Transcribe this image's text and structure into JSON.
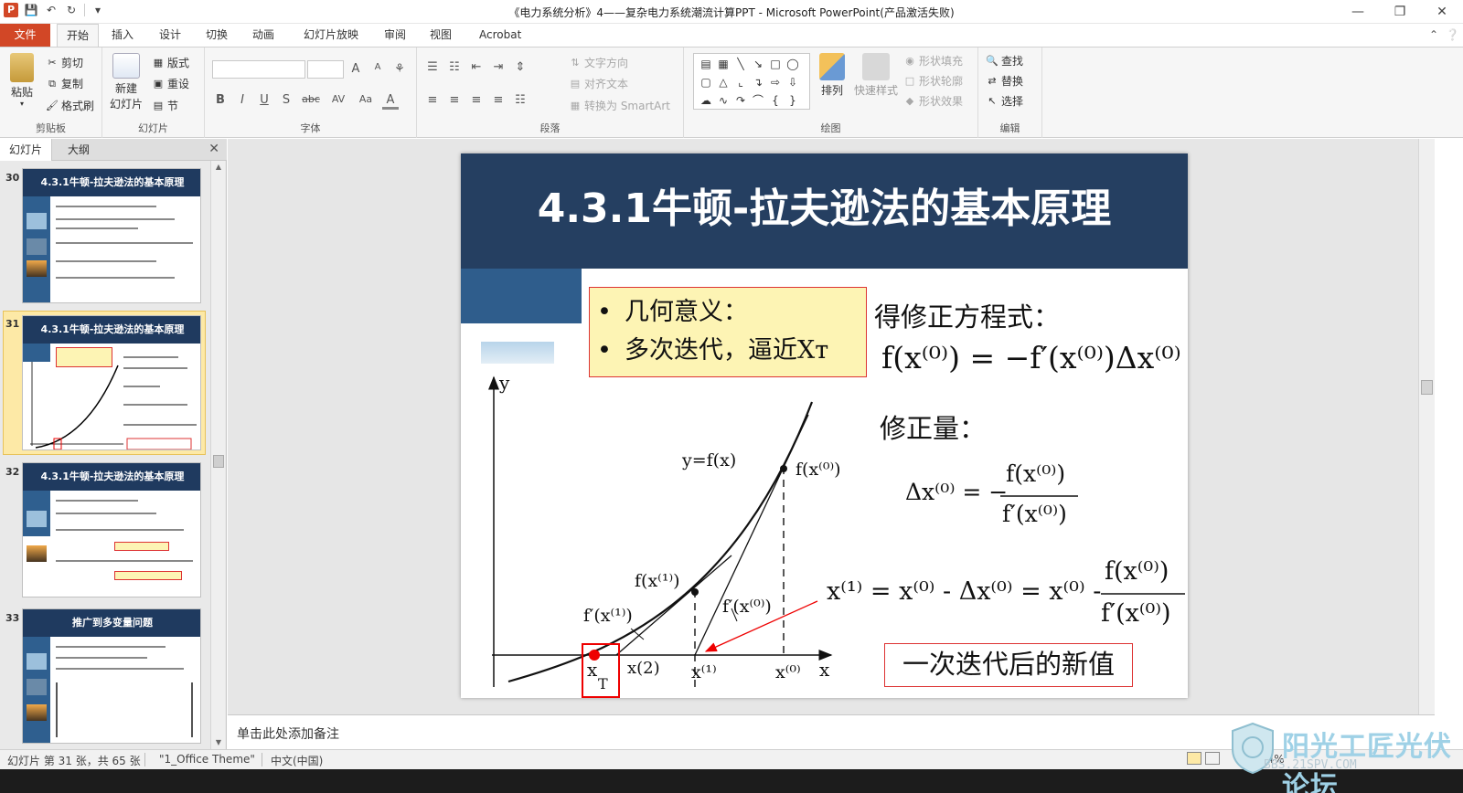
{
  "window": {
    "title": "《电力系统分析》4——复杂电力系统潮流计算PPT  -  Microsoft PowerPoint(产品激活失败)",
    "app_badge": "P"
  },
  "tabs": [
    "文件",
    "开始",
    "插入",
    "设计",
    "切换",
    "动画",
    "幻灯片放映",
    "审阅",
    "视图",
    "Acrobat"
  ],
  "ribbon": {
    "clipboard": {
      "paste": "粘贴",
      "cut": "剪切",
      "copy": "复制",
      "format_painter": "格式刷",
      "label": "剪贴板"
    },
    "slides": {
      "new_slide_1": "新建",
      "new_slide_2": "幻灯片",
      "layout": "版式",
      "reset": "重设",
      "section": "节",
      "label": "幻灯片"
    },
    "font": {
      "label": "字体",
      "bold": "B",
      "italic": "I",
      "underline": "U",
      "shadow": "S",
      "strike": "abc",
      "spacing": "AV",
      "case": "Aa",
      "color": "A",
      "grow": "A",
      "shrink": "A"
    },
    "paragraph": {
      "text_direction": "文字方向",
      "align_text": "对齐文本",
      "smartart": "转换为 SmartArt",
      "label": "段落"
    },
    "drawing": {
      "arrange": "排列",
      "quick_styles": "快速样式",
      "shape_fill": "形状填充",
      "shape_outline": "形状轮廓",
      "shape_effects": "形状效果",
      "label": "绘图"
    },
    "editing": {
      "find": "查找",
      "replace": "替换",
      "select": "选择",
      "label": "编辑"
    }
  },
  "left_panel": {
    "tab_slides": "幻灯片",
    "tab_outline": "大纲",
    "thumbnails": [
      {
        "num": "30",
        "title": "4.3.1牛顿-拉夫逊法的基本原理"
      },
      {
        "num": "31",
        "title": "4.3.1牛顿-拉夫逊法的基本原理"
      },
      {
        "num": "32",
        "title": "4.3.1牛顿-拉夫逊法的基本原理"
      },
      {
        "num": "33",
        "title": "推广到多变量问题"
      }
    ]
  },
  "slide": {
    "title": "4.3.1牛顿-拉夫逊法的基本原理",
    "bullets": [
      "几何意义：",
      "多次迭代，逼近Xт"
    ],
    "corr_eq_label": "得修正方程式：",
    "corr_eq": "f(x⁽⁰⁾) = −f′(x⁽⁰⁾)Δx⁽⁰⁾",
    "corr_amount_label": "修正量：",
    "corr_amount_lhs": "Δx⁽⁰⁾ = −",
    "corr_amount_num": "f(x⁽⁰⁾)",
    "corr_amount_den": "f′(x⁽⁰⁾)",
    "iter_eq_lhs": "x⁽¹⁾ = x⁽⁰⁾ - Δx⁽⁰⁾ = x⁽⁰⁾ -",
    "iter_eq_num": "f(x⁽⁰⁾)",
    "iter_eq_den": "f′(x⁽⁰⁾)",
    "new_value": "一次迭代后的新值",
    "graph_labels": {
      "y_axis": "y",
      "x_axis": "x",
      "curve": "y=f(x)",
      "f_x0": "f(x⁽⁰⁾)",
      "f_x1": "f(x⁽¹⁾)",
      "fp_x1": "f′(x⁽¹⁾)",
      "fp_x0": "f′(x⁽⁰⁾)",
      "x_T": "x",
      "x_T_sub": "T",
      "x2": "x(2)",
      "x1": "x⁽¹⁾",
      "x0": "x⁽⁰⁾"
    }
  },
  "notes": {
    "placeholder": "单击此处添加备注"
  },
  "status": {
    "slide_info": "幻灯片 第 31 张，共 65 张",
    "theme": "\"1_Office Theme\"",
    "language": "中文(中国)",
    "zoom": "84%"
  },
  "watermark": {
    "title": "阳光工匠光伏论坛",
    "url": "BBS.21SPV.COM"
  },
  "colors": {
    "accent": "#d24726",
    "slide_header": "#253f61",
    "slide_side": "#2f5d8c",
    "callout_fill": "#fdf4b4",
    "marker_red": "#e00000"
  }
}
